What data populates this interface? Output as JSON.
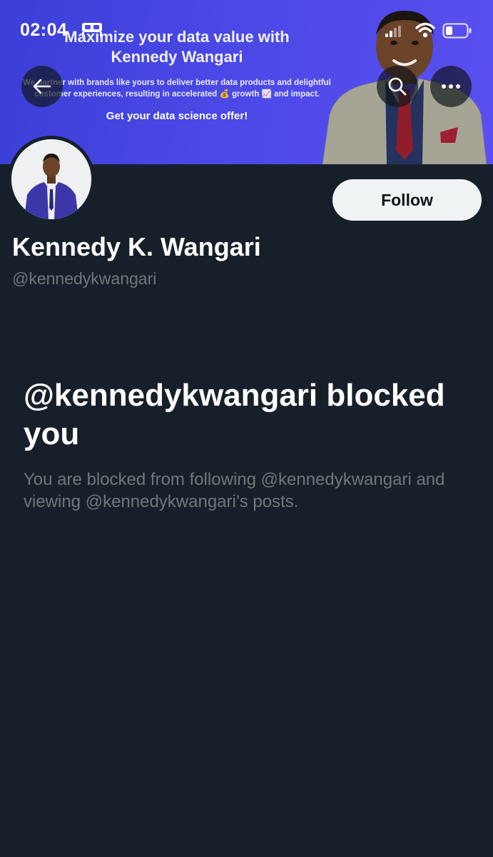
{
  "status_bar": {
    "time": "02:04"
  },
  "banner": {
    "headline_line1": "Maximize your data value with",
    "headline_line2": "Kennedy Wangari",
    "body": "We partner with brands like yours to deliver better data products and delightful customer experiences, resulting in accelerated 💰 growth 📈 and impact.",
    "cta": "Get your data science offer!",
    "background_color": "#4a48e6"
  },
  "nav": {
    "back_icon": "arrow-left-icon",
    "search_icon": "search-icon",
    "more_icon": "more-horizontal-icon"
  },
  "profile": {
    "display_name": "Kennedy K. Wangari",
    "handle": "@kennedykwangari",
    "follow_label": "Follow"
  },
  "blocked": {
    "title": "@kennedykwangari blocked you",
    "description": "You are blocked from following @kennedykwangari and viewing @kennedykwangari’s posts."
  },
  "colors": {
    "background": "#17202a",
    "secondary_text": "#71767b",
    "follow_button_bg": "#eff3f4"
  }
}
